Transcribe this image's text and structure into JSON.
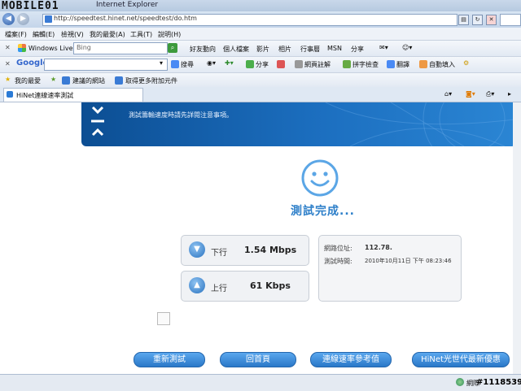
{
  "window": {
    "logo": "MOBILE01",
    "title": "Internet Explorer"
  },
  "address": {
    "url": "http://speedtest.hinet.net/speedtest/do.htm"
  },
  "menu": [
    "檔案(F)",
    "編輯(E)",
    "檢視(V)",
    "我的最愛(A)",
    "工具(T)",
    "說明(H)"
  ],
  "toolbar_live": {
    "brand": "Windows Live",
    "search_value": "Bing",
    "links": [
      "好友動向",
      "個人檔案",
      "影片",
      "相片",
      "行事曆",
      "MSN",
      "分享"
    ]
  },
  "toolbar_google": {
    "brand": "Google",
    "items": [
      "搜尋",
      "分享",
      "網頁註解",
      "拼字檢查",
      "翻譯",
      "自動填入"
    ]
  },
  "favorites": {
    "label": "我的最愛",
    "links": [
      "建議的網站",
      "取得更多附加元件"
    ]
  },
  "tab": {
    "title": "HiNet連線速率測試"
  },
  "banner": {
    "text": "測試籌輸速度時請先詳閱注意事項。"
  },
  "result": {
    "status": "測試完成..."
  },
  "speeds": {
    "download": {
      "label": "下行",
      "value": "1.54 Mbps"
    },
    "upload": {
      "label": "上行",
      "value": "61 Kbps"
    }
  },
  "info": {
    "ip_label": "網路位址:",
    "ip_value": "112.78.",
    "time_label": "測試時間:",
    "time_value": "2010年10月11日 下午 08:23:46"
  },
  "buttons": [
    "重新測試",
    "回首頁",
    "連線速率參考值",
    "HiNet光世代最新優惠"
  ],
  "statusbar": {
    "text": "網際",
    "watermark": "#1118539"
  },
  "colors": {
    "accent": "#2d7fc9",
    "button": "#3b8fde",
    "banner": "#1c6fc0"
  }
}
